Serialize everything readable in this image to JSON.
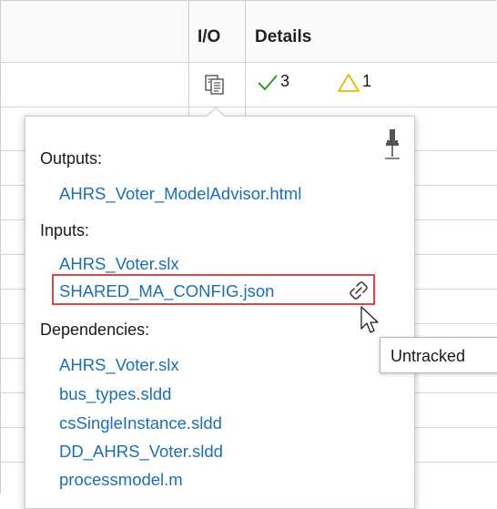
{
  "table": {
    "headers": {
      "blank": "",
      "io": "I/O",
      "details": "Details"
    },
    "row": {
      "pass_count": "3",
      "warn_count": "1"
    }
  },
  "popup": {
    "outputs_label": "Outputs:",
    "outputs": [
      "AHRS_Voter_ModelAdvisor.html"
    ],
    "inputs_label": "Inputs:",
    "inputs": [
      "AHRS_Voter.slx",
      "SHARED_MA_CONFIG.json"
    ],
    "dependencies_label": "Dependencies:",
    "dependencies": [
      "AHRS_Voter.slx",
      "bus_types.sldd",
      "csSingleInstance.sldd",
      "DD_AHRS_Voter.sldd",
      "processmodel.m"
    ]
  },
  "tooltip": {
    "text": "Untracked"
  },
  "colors": {
    "link": "#1a6fb7",
    "highlight": "#e0454e",
    "check": "#2e9a2e",
    "warn": "#f0b400"
  }
}
